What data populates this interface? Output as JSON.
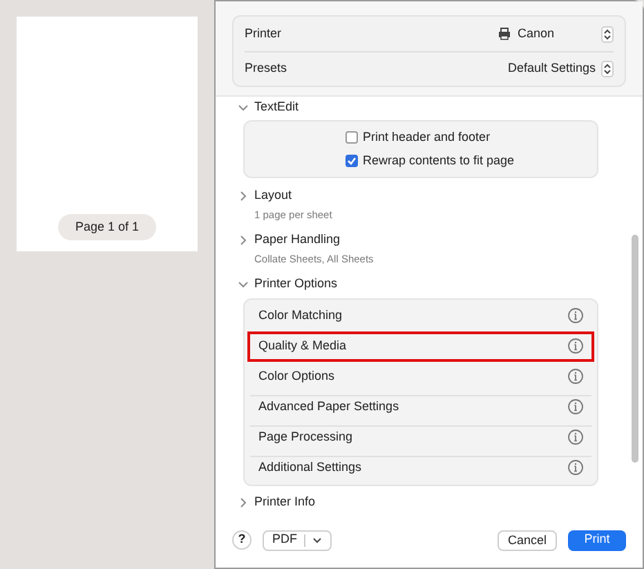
{
  "preview": {
    "page_label": "Page 1 of 1"
  },
  "settings": [
    {
      "label": "Printer",
      "value": "Canon",
      "kind": "printer"
    },
    {
      "label": "Presets",
      "value": "Default Settings",
      "kind": "plain"
    }
  ],
  "sections": [
    {
      "title": "TextEdit",
      "expanded": true,
      "kind": "checks",
      "options": [
        {
          "label": "Print header and footer",
          "checked": false
        },
        {
          "label": "Rewrap contents to fit page",
          "checked": true
        }
      ]
    },
    {
      "title": "Layout",
      "expanded": false,
      "kind": "summary",
      "subtitle": "1 page per sheet"
    },
    {
      "title": "Paper Handling",
      "expanded": false,
      "kind": "summary",
      "subtitle": "Collate Sheets, All Sheets"
    },
    {
      "title": "Printer Options",
      "expanded": true,
      "kind": "list",
      "items": [
        {
          "label": "Color Matching",
          "highlighted": false
        },
        {
          "label": "Quality & Media",
          "highlighted": true
        },
        {
          "label": "Color Options",
          "highlighted": false
        },
        {
          "label": "Advanced Paper Settings",
          "highlighted": false
        },
        {
          "label": "Page Processing",
          "highlighted": false
        },
        {
          "label": "Additional Settings",
          "highlighted": false
        }
      ]
    },
    {
      "title": "Printer Info",
      "expanded": false,
      "kind": "summary"
    }
  ],
  "footer": {
    "help": "?",
    "pdf": "PDF",
    "cancel": "Cancel",
    "print": "Print"
  }
}
